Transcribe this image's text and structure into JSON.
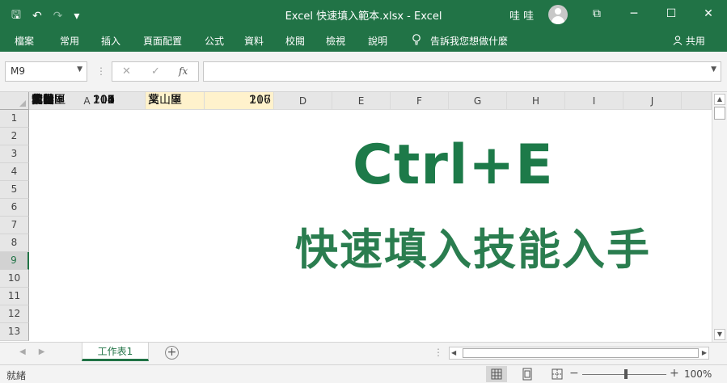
{
  "window": {
    "title": "Excel 快速填入範本.xlsx  -  Excel",
    "user": "哇 哇",
    "buttons": [
      "⧉",
      "─",
      "☐",
      "✕"
    ]
  },
  "qat": {
    "save": "🖫",
    "undo": "↶",
    "redo": "↷",
    "customize": "▾"
  },
  "ribbon": {
    "tabs": [
      "檔案",
      "常用",
      "插入",
      "頁面配置",
      "公式",
      "資料",
      "校閱",
      "檢視",
      "說明"
    ],
    "tell_me": "告訴我您想做什麼",
    "share": "共用"
  },
  "formula_bar": {
    "name_box": "M9",
    "fx": "fx",
    "cancel": "✕",
    "enter": "✓",
    "value": ""
  },
  "columns": [
    "A",
    "B",
    "C",
    "D",
    "E",
    "F",
    "G",
    "H",
    "I",
    "J"
  ],
  "rows": [
    {
      "n": "1",
      "a_name": "中正區",
      "a_code": "100",
      "b": "中正區",
      "c": "100"
    },
    {
      "n": "2",
      "a_name": "大同區",
      "a_code": "103",
      "b": "大同區",
      "c": "103"
    },
    {
      "n": "3",
      "a_name": "中山區",
      "a_code": "104",
      "b": "中山區",
      "c": "104"
    },
    {
      "n": "4",
      "a_name": "松山區",
      "a_code": "105",
      "b": "松山區",
      "c": "105"
    },
    {
      "n": "5",
      "a_name": "大安區",
      "a_code": "106",
      "b": "大安區",
      "c": "106"
    },
    {
      "n": "6",
      "a_name": "萬華區",
      "a_code": "108",
      "b": "萬華區",
      "c": "108"
    },
    {
      "n": "7",
      "a_name": "信義區",
      "a_code": "110",
      "b": "信義區",
      "c": "110"
    },
    {
      "n": "8",
      "a_name": "士林區",
      "a_code": "111",
      "b": "士林區",
      "c": "111"
    },
    {
      "n": "9",
      "a_name": "北投區",
      "a_code": "112",
      "b": "北投區",
      "c": "112"
    },
    {
      "n": "10",
      "a_name": "內湖區",
      "a_code": "114",
      "b": "內湖區",
      "c": "114"
    },
    {
      "n": "11",
      "a_name": "南港區",
      "a_code": "115",
      "b": "南港區",
      "c": "115"
    },
    {
      "n": "12",
      "a_name": "文山區",
      "a_code": "116",
      "b": "文山區",
      "c": "116"
    },
    {
      "n": "13",
      "a_name": "萬　里",
      "a_code": "207",
      "b": "萬　里",
      "c": "207"
    }
  ],
  "selected_row": "9",
  "overlay": {
    "title": "Ctrl+E",
    "subtitle": "快速填入技能入手"
  },
  "sheets": {
    "active": "工作表1",
    "add": "+"
  },
  "status": {
    "text": "就緒",
    "zoom": "100%"
  },
  "colors": {
    "brand": "#217346",
    "highlight": "#fff2cc",
    "overlay_text": "#1d7a49"
  }
}
